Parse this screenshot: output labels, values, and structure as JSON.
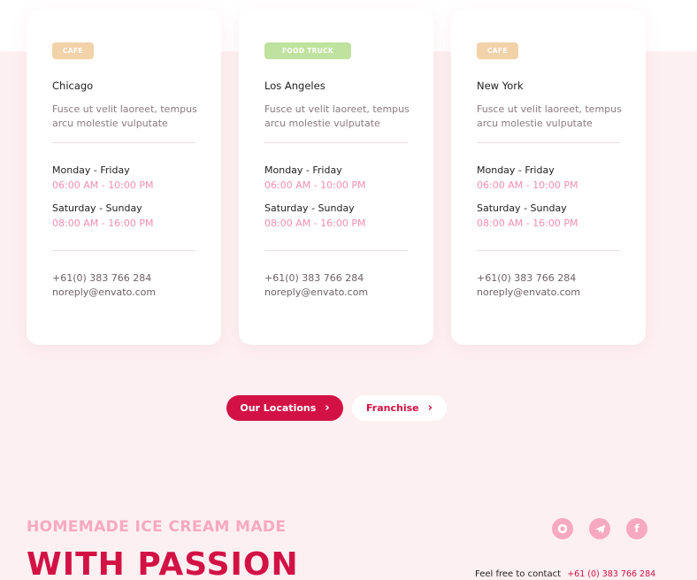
{
  "locations": [
    {
      "badge": "CAFE",
      "badge_color": "#f2d2a9",
      "city": "Chicago",
      "description": "Fusce ut velit laoreet, tempus arcu molestie vulputate",
      "weekday_label": "Monday - Friday",
      "weekday_hours": "06:00 AM - 10:00 PM",
      "weekend_label": "Saturday - Sunday",
      "weekend_hours": "08:00 AM - 16:00 PM",
      "phone": "+61(0) 383 766 284",
      "email": "noreply@envato.com"
    },
    {
      "badge": "FOOD TRUCK",
      "badge_color": "#bfe39e",
      "city": "Los Angeles",
      "description": "Fusce ut velit laoreet, tempus arcu molestie vulputate",
      "weekday_label": "Monday - Friday",
      "weekday_hours": "06:00 AM - 10:00 PM",
      "weekend_label": "Saturday - Sunday",
      "weekend_hours": "08:00 AM - 16:00 PM",
      "phone": "+61(0) 383 766 284",
      "email": "noreply@envato.com"
    },
    {
      "badge": "CAFE",
      "badge_color": "#f2d2a9",
      "city": "New York",
      "description": "Fusce ut velit laoreet, tempus arcu molestie vulputate",
      "weekday_label": "Monday - Friday",
      "weekday_hours": "06:00 AM - 10:00 PM",
      "weekend_label": "Saturday - Sunday",
      "weekend_hours": "08:00 AM - 16:00 PM",
      "phone": "+61(0) 383 766 284",
      "email": "noreply@envato.com"
    }
  ],
  "buttons": {
    "primary_label": "Our Locations",
    "secondary_label": "Franchise"
  },
  "footer": {
    "tagline": "HOMEMADE ICE CREAM MADE",
    "headline": "WITH PASSION",
    "contact_label": "Feel free to contact",
    "contact_phone": "+61 (0) 383 766 284",
    "socials": [
      "github-icon",
      "telegram-icon",
      "facebook-icon"
    ]
  },
  "colors": {
    "brand": "#d21245",
    "accent_pink": "#f28fb0",
    "background": "#fdf0f2"
  }
}
